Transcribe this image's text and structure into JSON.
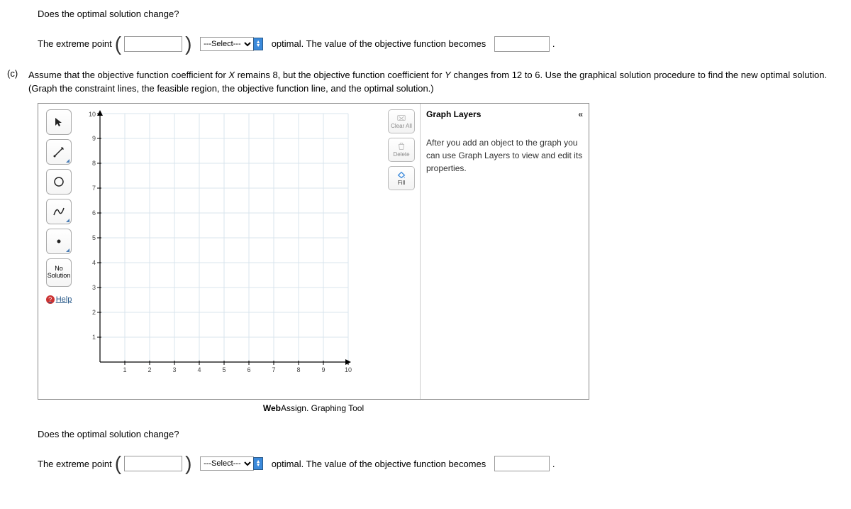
{
  "q1_change": "Does the optimal solution change?",
  "answer": {
    "extreme_point": "The extreme point",
    "select_placeholder": "---Select---",
    "optimal_text": "optimal. The value of the objective function becomes",
    "period": "."
  },
  "part_c": {
    "label": "(c)",
    "text_1": "Assume that the objective function coefficient for ",
    "x": "X",
    "text_2": " remains 8, but the objective function coefficient for ",
    "y": "Y",
    "text_3": " changes from 12 to 6. Use the graphical solution procedure to find the new optimal solution. (Graph the constraint lines, the feasible region, the objective function line, and the optimal solution.)"
  },
  "tools": {
    "no_solution_l1": "No",
    "no_solution_l2": "Solution"
  },
  "actions": {
    "clear_all": "Clear All",
    "delete": "Delete",
    "fill": "Fill"
  },
  "layers": {
    "title": "Graph Layers",
    "body": "After you add an object to the graph you can use Graph Layers to view and edit its properties."
  },
  "webassign": {
    "brand1": "Web",
    "brand2": "Assign",
    "suffix": ". Graphing Tool"
  },
  "help": "Help",
  "q2_change": "Does the optimal solution change?",
  "chart_data": {
    "type": "scatter",
    "title": "",
    "xlabel": "",
    "ylabel": "",
    "xlim": [
      0,
      10
    ],
    "ylim": [
      0,
      10
    ],
    "x_ticks": [
      1,
      2,
      3,
      4,
      5,
      6,
      7,
      8,
      9,
      10
    ],
    "y_ticks": [
      1,
      2,
      3,
      4,
      5,
      6,
      7,
      8,
      9,
      10
    ],
    "series": []
  }
}
